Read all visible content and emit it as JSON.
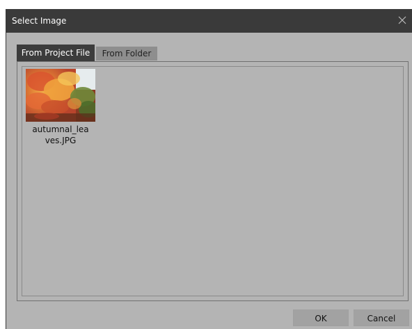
{
  "dialog": {
    "title": "Select Image",
    "close_icon": "close-icon"
  },
  "tabs": [
    {
      "label": "From Project File",
      "active": true
    },
    {
      "label": "From Folder",
      "active": false
    }
  ],
  "files": [
    {
      "name": "autumnal_leaves.JPG",
      "display_lines": [
        "autumnal_lea",
        "ves.JPG"
      ],
      "thumbnail": "autumn-leaves-thumbnail"
    }
  ],
  "buttons": {
    "ok": "OK",
    "cancel": "Cancel"
  },
  "colors": {
    "titlebar": "#3a3a3a",
    "body": "#b4b4b4",
    "active_tab": "#3c3c3c",
    "inactive_tab": "#8e8e8e",
    "button": "#a2a2a2"
  }
}
